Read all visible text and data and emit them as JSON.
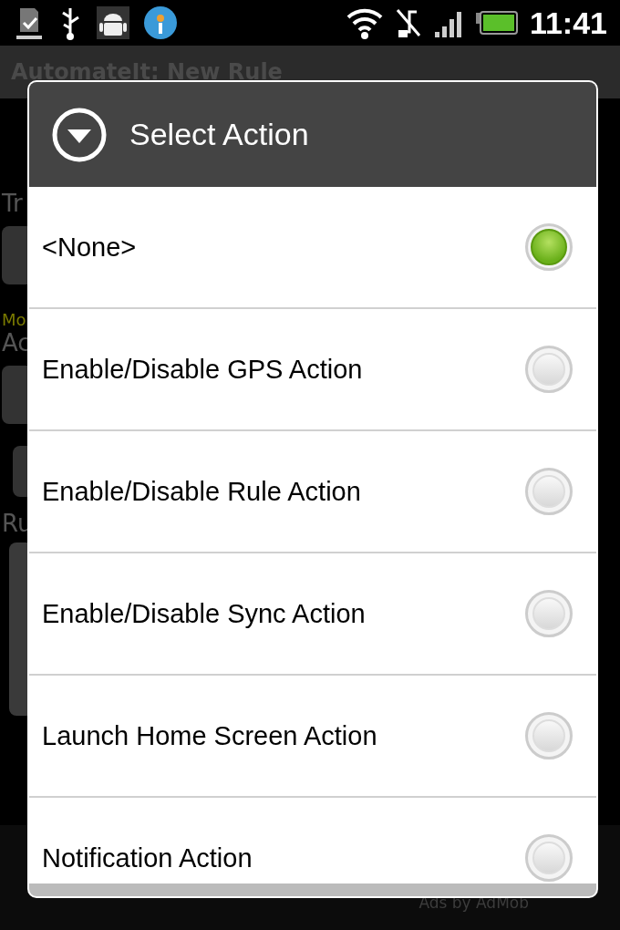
{
  "status_bar": {
    "time": "11:41"
  },
  "background": {
    "title": "AutomateIt: New Rule",
    "labels": [
      {
        "text": "Tr",
        "kind": "caption"
      },
      {
        "text": "Mo",
        "kind": "hint"
      },
      {
        "text": "Ac",
        "kind": "caption"
      },
      {
        "text": "Ru",
        "kind": "caption"
      }
    ],
    "ad_text": "Ads by AdMob"
  },
  "dialog": {
    "title": "Select Action",
    "options": [
      {
        "label": "<None>",
        "selected": true
      },
      {
        "label": "Enable/Disable GPS Action",
        "selected": false
      },
      {
        "label": "Enable/Disable Rule Action",
        "selected": false
      },
      {
        "label": "Enable/Disable Sync Action",
        "selected": false
      },
      {
        "label": "Launch Home Screen Action",
        "selected": false
      },
      {
        "label": "Notification Action",
        "selected": false
      }
    ]
  }
}
